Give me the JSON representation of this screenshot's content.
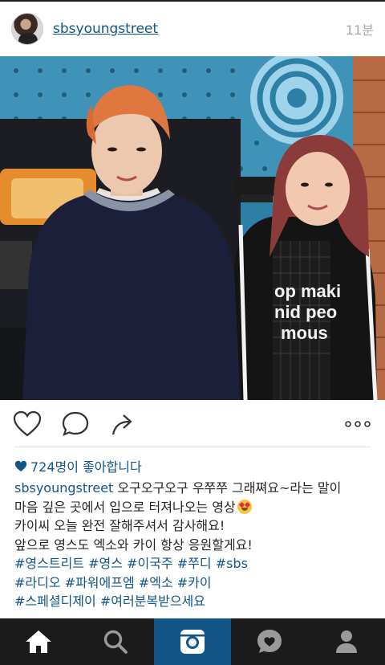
{
  "post": {
    "username": "sbsyoungstreet",
    "time_ago": "11분"
  },
  "media": {
    "shirt_text": [
      "op maki",
      "nid peo",
      "mous"
    ]
  },
  "likes": {
    "text": "724명이 좋아합니다"
  },
  "caption": {
    "username": "sbsyoungstreet",
    "line1_text": " 오구오구오구 우쭈쭈 그래쪄요~라는 말이",
    "line2_text": "마음 깊은 곳에서 입으로 터져나오는 영상",
    "line3_text": "카이씨 오늘 완전 잘해주셔서 감사해요!",
    "line4_text": "앞으로 영스도 엑소와 카이 항상 응원할게요!",
    "hashtags_row1": [
      "#영스트리트",
      "#영스",
      "#이국주",
      "#쭈디",
      "#sbs"
    ],
    "hashtags_row2": [
      "#라디오",
      "#파워에프엠",
      "#엑소",
      "#카이"
    ],
    "hashtags_row3": [
      "#스페셜디제이",
      "#여러분복받으세요"
    ]
  },
  "icons": {
    "like": "heart-outline-icon",
    "comment": "speech-bubble-icon",
    "share": "share-arrow-icon",
    "more": "more-dots-icon",
    "likes_heart": "heart-filled-icon",
    "emoji": "heart-eyes-emoji-icon",
    "nav": [
      "home-icon",
      "search-icon",
      "camera-icon",
      "activity-heart-icon",
      "profile-icon"
    ]
  },
  "colors": {
    "link": "#125688",
    "tabbar_bg": "#1b1b1b",
    "tab_active": "#125688",
    "time": "#a8a8a8"
  }
}
